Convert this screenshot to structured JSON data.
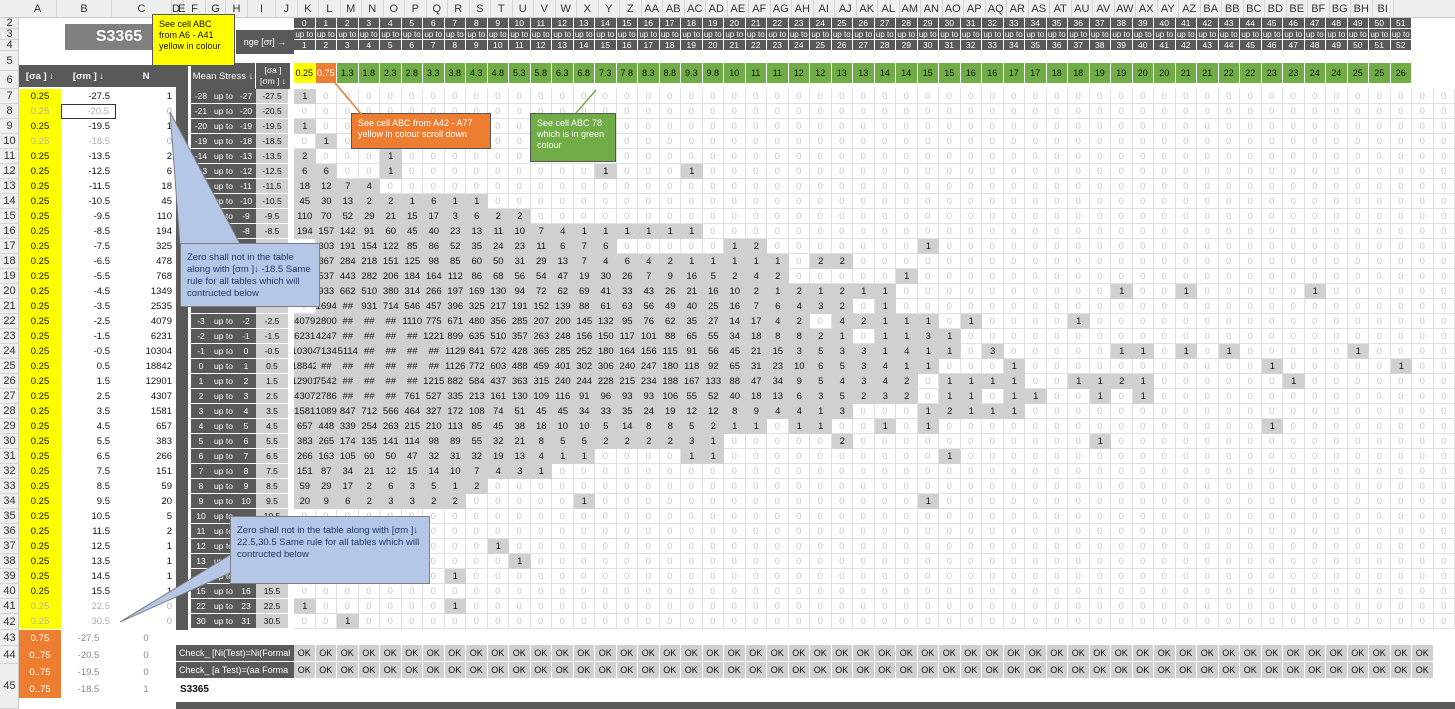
{
  "columns": [
    "A",
    "B",
    "C",
    "D",
    "E",
    "F",
    "G",
    "H",
    "I",
    "J",
    "K",
    "L",
    "M",
    "N",
    "O",
    "P",
    "Q",
    "R",
    "S",
    "T",
    "U",
    "V",
    "W",
    "X",
    "Y",
    "Z",
    "AA",
    "AB",
    "AC",
    "AD",
    "AE",
    "AF",
    "AG",
    "AH",
    "AI",
    "AJ",
    "AK",
    "AL",
    "AM",
    "AN",
    "AO",
    "AP",
    "AQ",
    "AR",
    "AS",
    "AT",
    "AU",
    "AV",
    "AW",
    "AX",
    "AY",
    "AZ",
    "BA",
    "BB",
    "BC",
    "BD",
    "BE",
    "BF",
    "BG",
    "BH",
    "BI"
  ],
  "rows": [
    "2",
    "3",
    "4",
    "5",
    "6",
    "7",
    "8",
    "9",
    "10",
    "11",
    "12",
    "13",
    "14",
    "15",
    "16",
    "17",
    "18",
    "19",
    "20",
    "21",
    "22",
    "23",
    "24",
    "25",
    "26",
    "27",
    "28",
    "29",
    "30",
    "31",
    "32",
    "33",
    "34",
    "35",
    "36",
    "37",
    "38",
    "39",
    "40",
    "41",
    "42",
    "43",
    "44",
    "45"
  ],
  "title": "S3365",
  "range_header": "nge [σr] →",
  "left_headers": {
    "sa": "[σa ] ↓",
    "sm": "[σm ] ↓",
    "n": "N"
  },
  "mean_stress_label": "Mean Stress ↓",
  "sa_sm_label": "[σa ] [σm ] ↓",
  "left_table": [
    [
      "0.25",
      "-27.5",
      "1"
    ],
    [
      "0.25",
      "-20.5",
      "0"
    ],
    [
      "0.25",
      "-19.5",
      "1"
    ],
    [
      "0.25",
      "-18.5",
      "0"
    ],
    [
      "0.25",
      "-13.5",
      "2"
    ],
    [
      "0.25",
      "-12.5",
      "6"
    ],
    [
      "0.25",
      "-11.5",
      "18"
    ],
    [
      "0.25",
      "-10.5",
      "45"
    ],
    [
      "0.25",
      "-9.5",
      "110"
    ],
    [
      "0.25",
      "-8.5",
      "194"
    ],
    [
      "0.25",
      "-7.5",
      "325"
    ],
    [
      "0.25",
      "-6.5",
      "478"
    ],
    [
      "0.25",
      "-5.5",
      "768"
    ],
    [
      "0.25",
      "-4.5",
      "1349"
    ],
    [
      "0.25",
      "-3.5",
      "2535"
    ],
    [
      "0.25",
      "-2.5",
      "4079"
    ],
    [
      "0.25",
      "-1.5",
      "6231"
    ],
    [
      "0.25",
      "-0.5",
      "10304"
    ],
    [
      "0.25",
      "0.5",
      "18842"
    ],
    [
      "0.25",
      "1.5",
      "12901"
    ],
    [
      "0.25",
      "2.5",
      "4307"
    ],
    [
      "0.25",
      "3.5",
      "1581"
    ],
    [
      "0.25",
      "4.5",
      "657"
    ],
    [
      "0.25",
      "5.5",
      "383"
    ],
    [
      "0.25",
      "6.5",
      "266"
    ],
    [
      "0.25",
      "7.5",
      "151"
    ],
    [
      "0.25",
      "8.5",
      "59"
    ],
    [
      "0.25",
      "9.5",
      "20"
    ],
    [
      "0.25",
      "10.5",
      "5"
    ],
    [
      "0.25",
      "11.5",
      "2"
    ],
    [
      "0.25",
      "12.5",
      "1"
    ],
    [
      "0.25",
      "13.5",
      "1"
    ],
    [
      "0.25",
      "14.5",
      "1"
    ],
    [
      "0.25",
      "15.5",
      "1"
    ],
    [
      "0.25",
      "22.5",
      "0"
    ],
    [
      "0.25",
      "30.5",
      "0"
    ]
  ],
  "orange_rows": [
    [
      "0.75",
      "-27.5",
      "0"
    ],
    [
      "0..75",
      "-20.5",
      "0"
    ],
    [
      "0..75",
      "-19.5",
      "0"
    ],
    [
      "0..75",
      "-18.5",
      "1"
    ]
  ],
  "range_rows": [
    [
      "-28",
      "up to",
      "-27",
      "-27.5"
    ],
    [
      "-21",
      "up to",
      "-20",
      "-20.5"
    ],
    [
      "-20",
      "up to",
      "-19",
      "-19.5"
    ],
    [
      "-19",
      "up to",
      "-18",
      "-18.5"
    ],
    [
      "-14",
      "up to",
      "-13",
      "-13.5"
    ],
    [
      "-13",
      "up to",
      "-12",
      "-12.5"
    ],
    [
      "-12",
      "up to",
      "-11",
      "-11.5"
    ],
    [
      "-11",
      "up to",
      "-10",
      "-10.5"
    ],
    [
      "-10",
      "up to",
      "-9",
      "-9.5"
    ],
    [
      "-9",
      "up to",
      "-8",
      "-8.5"
    ],
    [
      "",
      "",
      "",
      ""
    ],
    [
      "",
      "",
      "",
      ""
    ],
    [
      "",
      "",
      "",
      ""
    ],
    [
      "",
      "",
      "",
      ""
    ],
    [
      "",
      "",
      "",
      ""
    ],
    [
      "-3",
      "up to",
      "-2",
      "-2.5"
    ],
    [
      "-2",
      "up to",
      "-1",
      "-1.5"
    ],
    [
      "-1",
      "up to",
      "0",
      "-0.5"
    ],
    [
      "0",
      "up to",
      "1",
      "0.5"
    ],
    [
      "1",
      "up to",
      "2",
      "1.5"
    ],
    [
      "2",
      "up to",
      "3",
      "2.5"
    ],
    [
      "3",
      "up to",
      "4",
      "3.5"
    ],
    [
      "4",
      "up to",
      "5",
      "4.5"
    ],
    [
      "5",
      "up to",
      "6",
      "5.5"
    ],
    [
      "6",
      "up to",
      "7",
      "6.5"
    ],
    [
      "7",
      "up to",
      "8",
      "7.5"
    ],
    [
      "8",
      "up to",
      "9",
      "8.5"
    ],
    [
      "9",
      "up to",
      "10",
      "9.5"
    ],
    [
      "10",
      "up to",
      "",
      "10.5"
    ],
    [
      "11",
      "up to",
      "",
      "11.5"
    ],
    [
      "12",
      "up to",
      "",
      "12.5"
    ],
    [
      "13",
      "up to",
      "",
      "13.5"
    ],
    [
      "",
      "up to",
      "",
      "14.5"
    ],
    [
      "15",
      "up to",
      "16",
      "15.5"
    ],
    [
      "22",
      "up to",
      "23",
      "22.5"
    ],
    [
      "30",
      "up to",
      "31",
      "30.5"
    ]
  ],
  "grid_top": {
    "row2": [
      "0",
      "1",
      "2",
      "3",
      "4",
      "5",
      "6",
      "7",
      "8",
      "9",
      "10",
      "11",
      "12",
      "13",
      "14",
      "15",
      "16",
      "17",
      "18",
      "19",
      "20",
      "21",
      "22",
      "23",
      "24",
      "25",
      "26",
      "27",
      "28",
      "29",
      "30",
      "31",
      "32",
      "33",
      "34",
      "35",
      "36",
      "37",
      "38",
      "39",
      "40",
      "41",
      "42",
      "43",
      "44",
      "45",
      "46",
      "47",
      "48",
      "49",
      "50",
      "51"
    ],
    "row3": "up to",
    "row4": [
      "1",
      "2",
      "3",
      "4",
      "5",
      "6",
      "7",
      "8",
      "9",
      "10",
      "11",
      "12",
      "13",
      "14",
      "15",
      "16",
      "17",
      "18",
      "19",
      "20",
      "21",
      "22",
      "23",
      "24",
      "25",
      "26",
      "27",
      "28",
      "29",
      "30",
      "31",
      "32",
      "33",
      "34",
      "35",
      "36",
      "37",
      "38",
      "39",
      "40",
      "41",
      "42",
      "43",
      "44",
      "45",
      "46",
      "47",
      "48",
      "49",
      "50",
      "51",
      "52"
    ],
    "row5": [
      "0.25",
      "0.75",
      "1.3",
      "1.8",
      "2.3",
      "2.8",
      "3.3",
      "3.8",
      "4.3",
      "4.8",
      "5.3",
      "5.8",
      "6.3",
      "6.8",
      "7.3",
      "7.8",
      "8.3",
      "8.8",
      "9.3",
      "9.8",
      "10",
      "11",
      "11",
      "12",
      "12",
      "13",
      "13",
      "14",
      "14",
      "15",
      "15",
      "16",
      "16",
      "17",
      "17",
      "18",
      "18",
      "19",
      "19",
      "20",
      "20",
      "21",
      "21",
      "22",
      "22",
      "23",
      "23",
      "24",
      "24",
      "25",
      "25",
      "26"
    ]
  },
  "matrix": [
    [
      "1"
    ],
    [],
    [
      "1"
    ],
    [
      "",
      "1"
    ],
    [
      "2",
      "",
      "",
      "",
      "1"
    ],
    [
      "6",
      "6",
      "",
      "",
      "1",
      "",
      "",
      "",
      "",
      "",
      "",
      "",
      "",
      "",
      "1",
      "",
      "",
      "",
      "1"
    ],
    [
      "18",
      "12",
      "7",
      "4"
    ],
    [
      "45",
      "30",
      "13",
      "2",
      "2",
      "1",
      "6",
      "1",
      "1"
    ],
    [
      "110",
      "70",
      "52",
      "29",
      "21",
      "15",
      "17",
      "3",
      "6",
      "2",
      "2"
    ],
    [
      "194",
      "157",
      "142",
      "91",
      "60",
      "45",
      "40",
      "23",
      "13",
      "11",
      "10",
      "7",
      "4",
      "1",
      "1",
      "1",
      "1",
      "1",
      "1"
    ],
    [
      "",
      "303",
      "191",
      "154",
      "122",
      "85",
      "86",
      "52",
      "35",
      "24",
      "23",
      "11",
      "6",
      "7",
      "6",
      "",
      "",
      "",
      "",
      "",
      "1",
      "2",
      "",
      "",
      "",
      "",
      "",
      "",
      "",
      "1"
    ],
    [
      "",
      "367",
      "284",
      "218",
      "151",
      "125",
      "98",
      "85",
      "60",
      "50",
      "31",
      "29",
      "13",
      "7",
      "4",
      "6",
      "4",
      "2",
      "1",
      "1",
      "1",
      "1",
      "1",
      "",
      "2",
      "2"
    ],
    [
      "",
      "537",
      "443",
      "282",
      "206",
      "184",
      "164",
      "112",
      "86",
      "68",
      "56",
      "54",
      "47",
      "19",
      "30",
      "26",
      "7",
      "9",
      "16",
      "5",
      "2",
      "4",
      "2",
      "",
      "",
      "",
      "",
      "",
      "1"
    ],
    [
      "",
      "933",
      "662",
      "510",
      "380",
      "314",
      "266",
      "197",
      "169",
      "130",
      "94",
      "72",
      "62",
      "69",
      "41",
      "33",
      "43",
      "26",
      "21",
      "16",
      "10",
      "2",
      "1",
      "2",
      "1",
      "2",
      "1",
      "1",
      "",
      "",
      "",
      "",
      "",
      "",
      "",
      "",
      "",
      "",
      "1",
      "",
      "",
      "1",
      "",
      "",
      "",
      "",
      "",
      "1"
    ],
    [
      "",
      "1694",
      "##",
      "931",
      "714",
      "546",
      "457",
      "396",
      "325",
      "217",
      "191",
      "152",
      "139",
      "88",
      "61",
      "63",
      "56",
      "49",
      "40",
      "25",
      "16",
      "7",
      "6",
      "4",
      "3",
      "2",
      "",
      "1"
    ],
    [
      "4079",
      "2800",
      "##",
      "##",
      "##",
      "1110",
      "775",
      "671",
      "480",
      "356",
      "285",
      "207",
      "200",
      "145",
      "132",
      "95",
      "76",
      "62",
      "35",
      "27",
      "14",
      "17",
      "4",
      "2",
      "",
      "4",
      "2",
      "1",
      "1",
      "1",
      "",
      "1",
      "",
      "",
      "",
      "",
      "1"
    ],
    [
      "6231",
      "4247",
      "##",
      "##",
      "##",
      "##",
      "1221",
      "899",
      "635",
      "510",
      "357",
      "263",
      "248",
      "156",
      "150",
      "117",
      "101",
      "88",
      "65",
      "55",
      "34",
      "18",
      "8",
      "8",
      "2",
      "1",
      "",
      "1",
      "1",
      "3",
      "1"
    ],
    [
      "10304",
      "7134",
      "5114",
      "##",
      "##",
      "##",
      "##",
      "1129",
      "841",
      "572",
      "428",
      "365",
      "285",
      "252",
      "180",
      "164",
      "156",
      "115",
      "91",
      "56",
      "45",
      "21",
      "15",
      "3",
      "5",
      "3",
      "3",
      "1",
      "4",
      "1",
      "1",
      "",
      "3",
      "",
      "",
      "",
      "",
      "",
      "1",
      "1",
      "",
      "1",
      "",
      "1",
      "",
      "",
      "",
      "",
      "",
      "1",
      "",
      "",
      "",
      "",
      "",
      "1"
    ],
    [
      "18842",
      "##",
      "##",
      "##",
      "##",
      "##",
      "##",
      "1126",
      "772",
      "603",
      "488",
      "459",
      "401",
      "302",
      "306",
      "240",
      "247",
      "180",
      "118",
      "92",
      "65",
      "31",
      "23",
      "10",
      "6",
      "5",
      "3",
      "4",
      "1",
      "1",
      "",
      "",
      "",
      "1",
      "",
      "",
      "",
      "",
      "",
      "",
      "",
      "",
      "",
      "",
      "",
      "1",
      "",
      "",
      "",
      "",
      "",
      "1"
    ],
    [
      "12901",
      "7542",
      "##",
      "##",
      "##",
      "##",
      "1215",
      "882",
      "584",
      "437",
      "363",
      "315",
      "240",
      "244",
      "228",
      "215",
      "234",
      "188",
      "167",
      "133",
      "88",
      "47",
      "34",
      "9",
      "5",
      "4",
      "3",
      "4",
      "2",
      "",
      "1",
      "1",
      "1",
      "1",
      "",
      "",
      "1",
      "1",
      "2",
      "1",
      "",
      "",
      "",
      "",
      "",
      "",
      "1"
    ],
    [
      "4307",
      "2786",
      "##",
      "##",
      "##",
      "761",
      "527",
      "335",
      "213",
      "161",
      "130",
      "109",
      "116",
      "91",
      "96",
      "93",
      "93",
      "106",
      "55",
      "52",
      "40",
      "18",
      "13",
      "6",
      "3",
      "5",
      "2",
      "3",
      "2",
      "",
      "1",
      "1",
      "",
      "1",
      "1",
      "",
      "",
      "1",
      "",
      "1"
    ],
    [
      "1581",
      "1089",
      "847",
      "712",
      "566",
      "464",
      "327",
      "172",
      "108",
      "74",
      "51",
      "45",
      "45",
      "34",
      "33",
      "35",
      "24",
      "19",
      "12",
      "12",
      "8",
      "9",
      "4",
      "4",
      "1",
      "3",
      "",
      "",
      "",
      "1",
      "2",
      "1",
      "1",
      "1"
    ],
    [
      "657",
      "448",
      "339",
      "254",
      "263",
      "215",
      "210",
      "113",
      "85",
      "45",
      "38",
      "18",
      "10",
      "10",
      "5",
      "14",
      "8",
      "8",
      "5",
      "2",
      "1",
      "1",
      "",
      "1",
      "1",
      "",
      "",
      "1",
      "",
      "1",
      "",
      "",
      "",
      "",
      "",
      "",
      "",
      "",
      "",
      "",
      "",
      "",
      "",
      "",
      "",
      "1"
    ],
    [
      "383",
      "265",
      "174",
      "135",
      "141",
      "114",
      "98",
      "89",
      "55",
      "32",
      "21",
      "8",
      "5",
      "5",
      "2",
      "2",
      "2",
      "2",
      "3",
      "1",
      "",
      "",
      "",
      "",
      "",
      "2",
      "",
      "",
      "",
      "",
      "",
      "",
      "",
      "",
      "",
      "",
      "",
      "1"
    ],
    [
      "266",
      "163",
      "105",
      "60",
      "50",
      "47",
      "32",
      "31",
      "32",
      "19",
      "13",
      "4",
      "1",
      "1",
      "",
      "",
      "",
      "",
      "1",
      "1",
      "",
      "",
      "",
      "",
      "",
      "",
      "",
      "",
      "",
      "",
      "1"
    ],
    [
      "151",
      "87",
      "34",
      "21",
      "12",
      "15",
      "14",
      "10",
      "7",
      "4",
      "3",
      "1"
    ],
    [
      "59",
      "29",
      "17",
      "2",
      "6",
      "3",
      "5",
      "1",
      "2"
    ],
    [
      "20",
      "9",
      "6",
      "2",
      "3",
      "3",
      "2",
      "2",
      "",
      "",
      "",
      "",
      "",
      "1",
      "",
      "",
      "",
      "",
      "",
      "",
      "",
      "",
      "",
      "",
      "",
      "",
      "",
      "",
      "",
      "1"
    ],
    [],
    [],
    [
      "",
      "",
      "",
      "",
      "",
      "",
      "",
      "",
      "",
      "1"
    ],
    [
      "",
      "",
      "",
      "",
      "",
      "",
      "",
      "",
      "",
      "",
      "1"
    ],
    [
      "",
      "",
      "",
      "",
      "",
      "",
      "",
      "1"
    ],
    [],
    [
      "1",
      "",
      "",
      "",
      "",
      "",
      "",
      "1"
    ],
    [
      "",
      "",
      "1"
    ],
    [
      "",
      "",
      "",
      "1"
    ]
  ],
  "check_rows": [
    {
      "label": "Check_ [Ni(Test)=Ni(Formal",
      "value": "OK"
    },
    {
      "label": "Check_ [a Test)=(aa Forma",
      "value": "OK"
    }
  ],
  "bottom_label": "S3365",
  "notes": {
    "yellow": "See cell ABC from A6 - A41 yellow in colour",
    "orange": "See cell ABC from A42 - A77 yellow in colour scroll down",
    "green": "See cell ABC 78 which is in green colour",
    "callout1": "Zero shall not in the table along with [σm ]↓ -18.5 Same rule for all tables which will contructed below",
    "callout2": "Zero shall not in the table along with [σm ]↓ 22.5,30.5 Same rule for all tables which will contructed below"
  }
}
